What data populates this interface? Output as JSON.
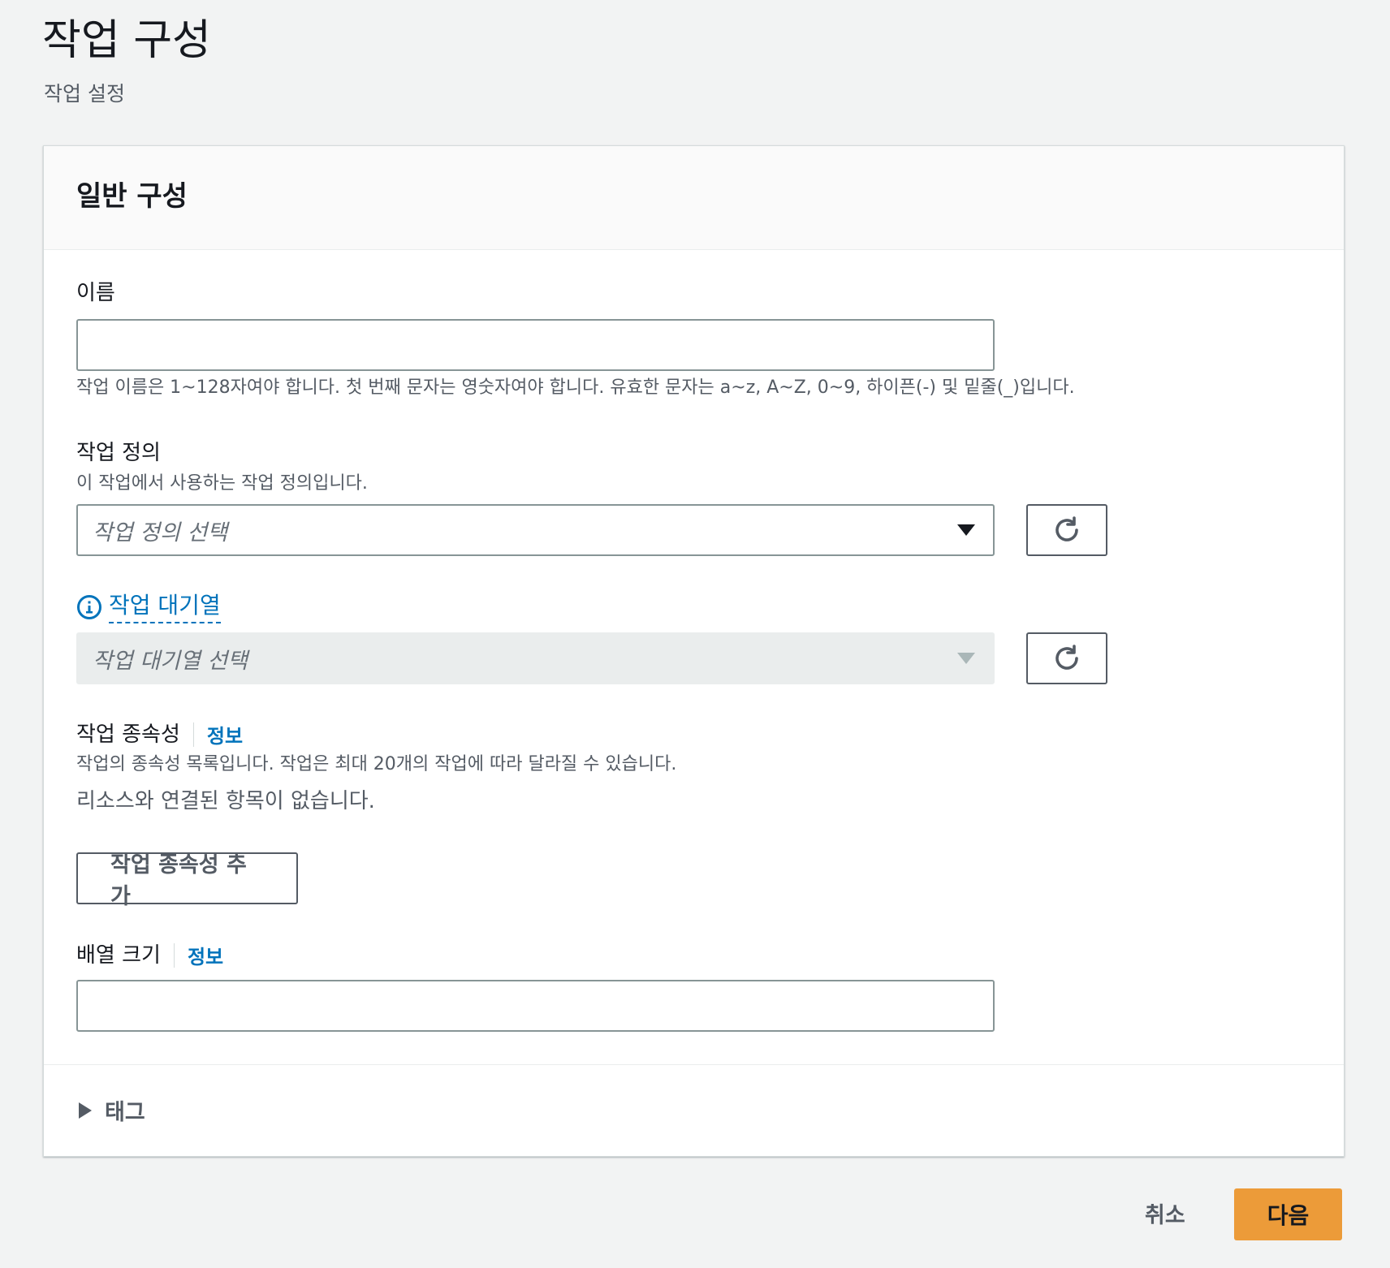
{
  "header": {
    "title": "작업 구성",
    "subtitle": "작업 설정"
  },
  "panel": {
    "title": "일반 구성",
    "name_field": {
      "label": "이름",
      "value": "",
      "description": "작업 이름은 1~128자여야 합니다. 첫 번째 문자는 영숫자여야 합니다. 유효한 문자는 a~z, A~Z, 0~9, 하이픈(-) 및 밑줄(_)입니다."
    },
    "job_definition": {
      "label": "작업 정의",
      "description": "이 작업에서 사용하는 작업 정의입니다.",
      "placeholder": "작업 정의 선택"
    },
    "job_queue": {
      "label": "작업 대기열",
      "placeholder": "작업 대기열 선택",
      "disabled": true
    },
    "dependencies": {
      "label": "작업 종속성",
      "info_link": "정보",
      "description": "작업의 종속성 목록입니다. 작업은 최대 20개의 작업에 따라 달라질 수 있습니다.",
      "empty_text": "리소스와 연결된 항목이 없습니다.",
      "add_button": "작업 종속성 추가"
    },
    "array_size": {
      "label": "배열 크기",
      "info_link": "정보",
      "value": ""
    },
    "tags": {
      "label": "태그",
      "expanded": false
    }
  },
  "footer": {
    "cancel_label": "취소",
    "next_label": "다음"
  },
  "icons": {
    "refresh": "refresh-icon",
    "info": "info-icon",
    "caret_down": "caret-down-icon",
    "caret_right": "caret-right-icon"
  },
  "colors": {
    "link": "#0073bb",
    "primary": "#ec9b39",
    "background": "#f2f3f3"
  }
}
